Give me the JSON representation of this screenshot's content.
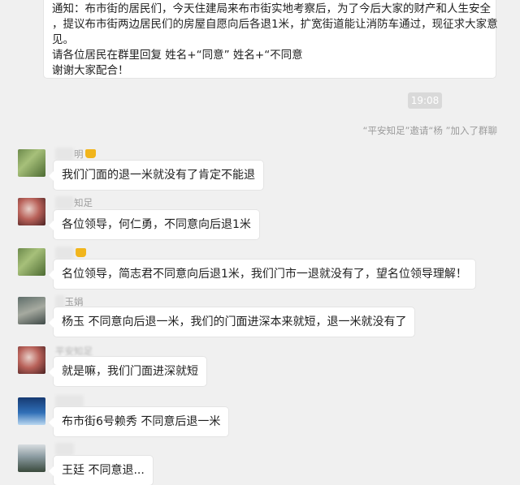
{
  "notice": {
    "lines": [
      "通知：布市街的居民们，今天住建局来布市街实地考察后，为了今后大家的财产和人生安全",
      "，提议布市街两边居民们的房屋自愿向后各退1米，扩宽街道能让消防车通过，现征求大家意",
      "见。",
      " 请各位居民在群里回复  姓名+“同意”   姓名+“不同意",
      "谢谢大家配合！"
    ]
  },
  "timestamp": "19:08",
  "system_message": "“平安知足”邀请“杨      ”加入了群聊",
  "messages": [
    {
      "name": "明",
      "text": "我们门面的退一米就没有了肯定不能退",
      "avatar": "green-landscape"
    },
    {
      "name": "知足",
      "text": "各位领导，何仁勇，不同意向后退1米",
      "avatar": "red-flowers"
    },
    {
      "name": "",
      "text": "名位领导，简志君不同意向后退1米，我们门市一退就没有了，望名位领导理解！",
      "avatar": "green-landscape"
    },
    {
      "name": "玉娟",
      "text": "杨玉     不同意向后退一米，我们的门面进深本来就短，退一米就没有了",
      "avatar": "rock"
    },
    {
      "name": "平安知足",
      "text": "就是嘛，我们门面进深就短",
      "avatar": "red-flowers"
    },
    {
      "name": "",
      "text": "布市街6号赖秀     不同意后退一米",
      "avatar": "blue-sky"
    },
    {
      "name": "",
      "text": "王廷      不同意退...",
      "avatar": "tree"
    }
  ],
  "colors": {
    "background": "#f0f0f0",
    "bubble": "#ffffff",
    "timestamp_bg": "#d9d9d9",
    "name_text": "#9c9c9c"
  }
}
